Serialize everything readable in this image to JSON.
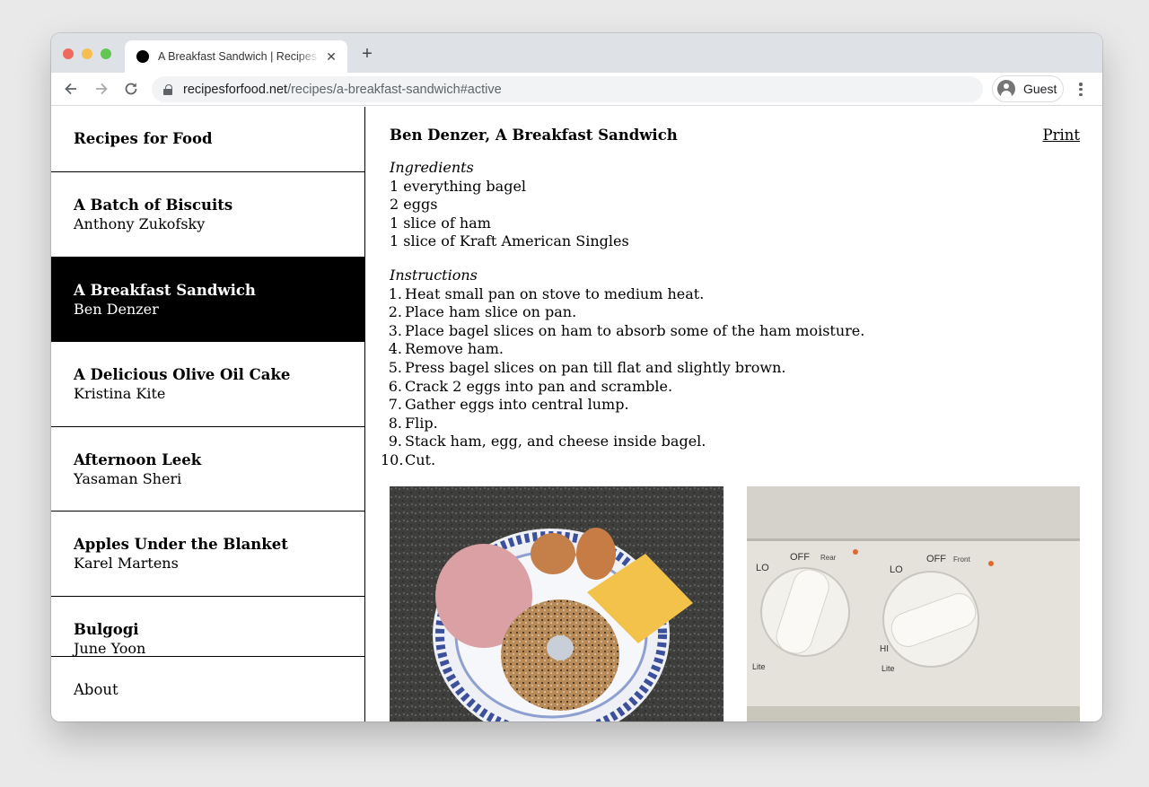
{
  "browser": {
    "tab_title": "A Breakfast Sandwich | Recipes for Food",
    "new_tab_label": "+",
    "url_domain": "recipesforfood.net",
    "url_path": "/recipes/a-breakfast-sandwich#active",
    "profile_label": "Guest",
    "icons": [
      "back-arrow-icon",
      "forward-arrow-icon",
      "reload-icon",
      "lock-icon",
      "avatar-icon",
      "more-vert-icon",
      "close-icon"
    ]
  },
  "site": {
    "title": "Recipes for Food",
    "about_label": "About"
  },
  "recipes": [
    {
      "name": "A Batch of Biscuits",
      "author": "Anthony Zukofsky"
    },
    {
      "name": "A Breakfast Sandwich",
      "author": "Ben Denzer",
      "active": true
    },
    {
      "name": "A Delicious Olive Oil Cake",
      "author": "Kristina Kite"
    },
    {
      "name": "Afternoon Leek",
      "author": "Yasaman Sheri"
    },
    {
      "name": "Apples Under the Blanket",
      "author": "Karel Martens"
    },
    {
      "name": "Bulgogi",
      "author": "June Yoon"
    }
  ],
  "recipe": {
    "heading": "Ben Denzer, A Breakfast Sandwich",
    "print_label": "Print",
    "ingredients_label": "Ingredients",
    "ingredients": [
      "1 everything bagel",
      "2 eggs",
      "1 slice of ham",
      "1 slice of Kraft American Singles"
    ],
    "instructions_label": "Instructions",
    "instructions": [
      {
        "num": "1.",
        "text": "Heat small pan on stove to medium heat."
      },
      {
        "num": "2.",
        "text": "Place ham slice on pan."
      },
      {
        "num": "3.",
        "text": "Place bagel slices on ham to absorb some of the ham moisture."
      },
      {
        "num": "4.",
        "text": "Remove ham."
      },
      {
        "num": "5.",
        "text": "Press bagel slices on pan till flat and slightly brown."
      },
      {
        "num": "6.",
        "text": "Crack 2 eggs into pan and scramble."
      },
      {
        "num": "7.",
        "text": "Gather eggs into central lump."
      },
      {
        "num": "8.",
        "text": "Flip."
      },
      {
        "num": "9.",
        "text": "Stack ham, egg, and cheese inside bagel."
      },
      {
        "num": "10.",
        "text": "Cut."
      }
    ],
    "stove_labels": {
      "off": "OFF",
      "rear": "Rear",
      "front": "Front",
      "lo": "LO",
      "hi": "HI",
      "lite": "Lite"
    }
  },
  "colors": {
    "active_bg": "#000000",
    "active_fg": "#ffffff",
    "omnibox_bg": "#f1f3f4",
    "tabstrip_bg": "#dee1e6"
  }
}
